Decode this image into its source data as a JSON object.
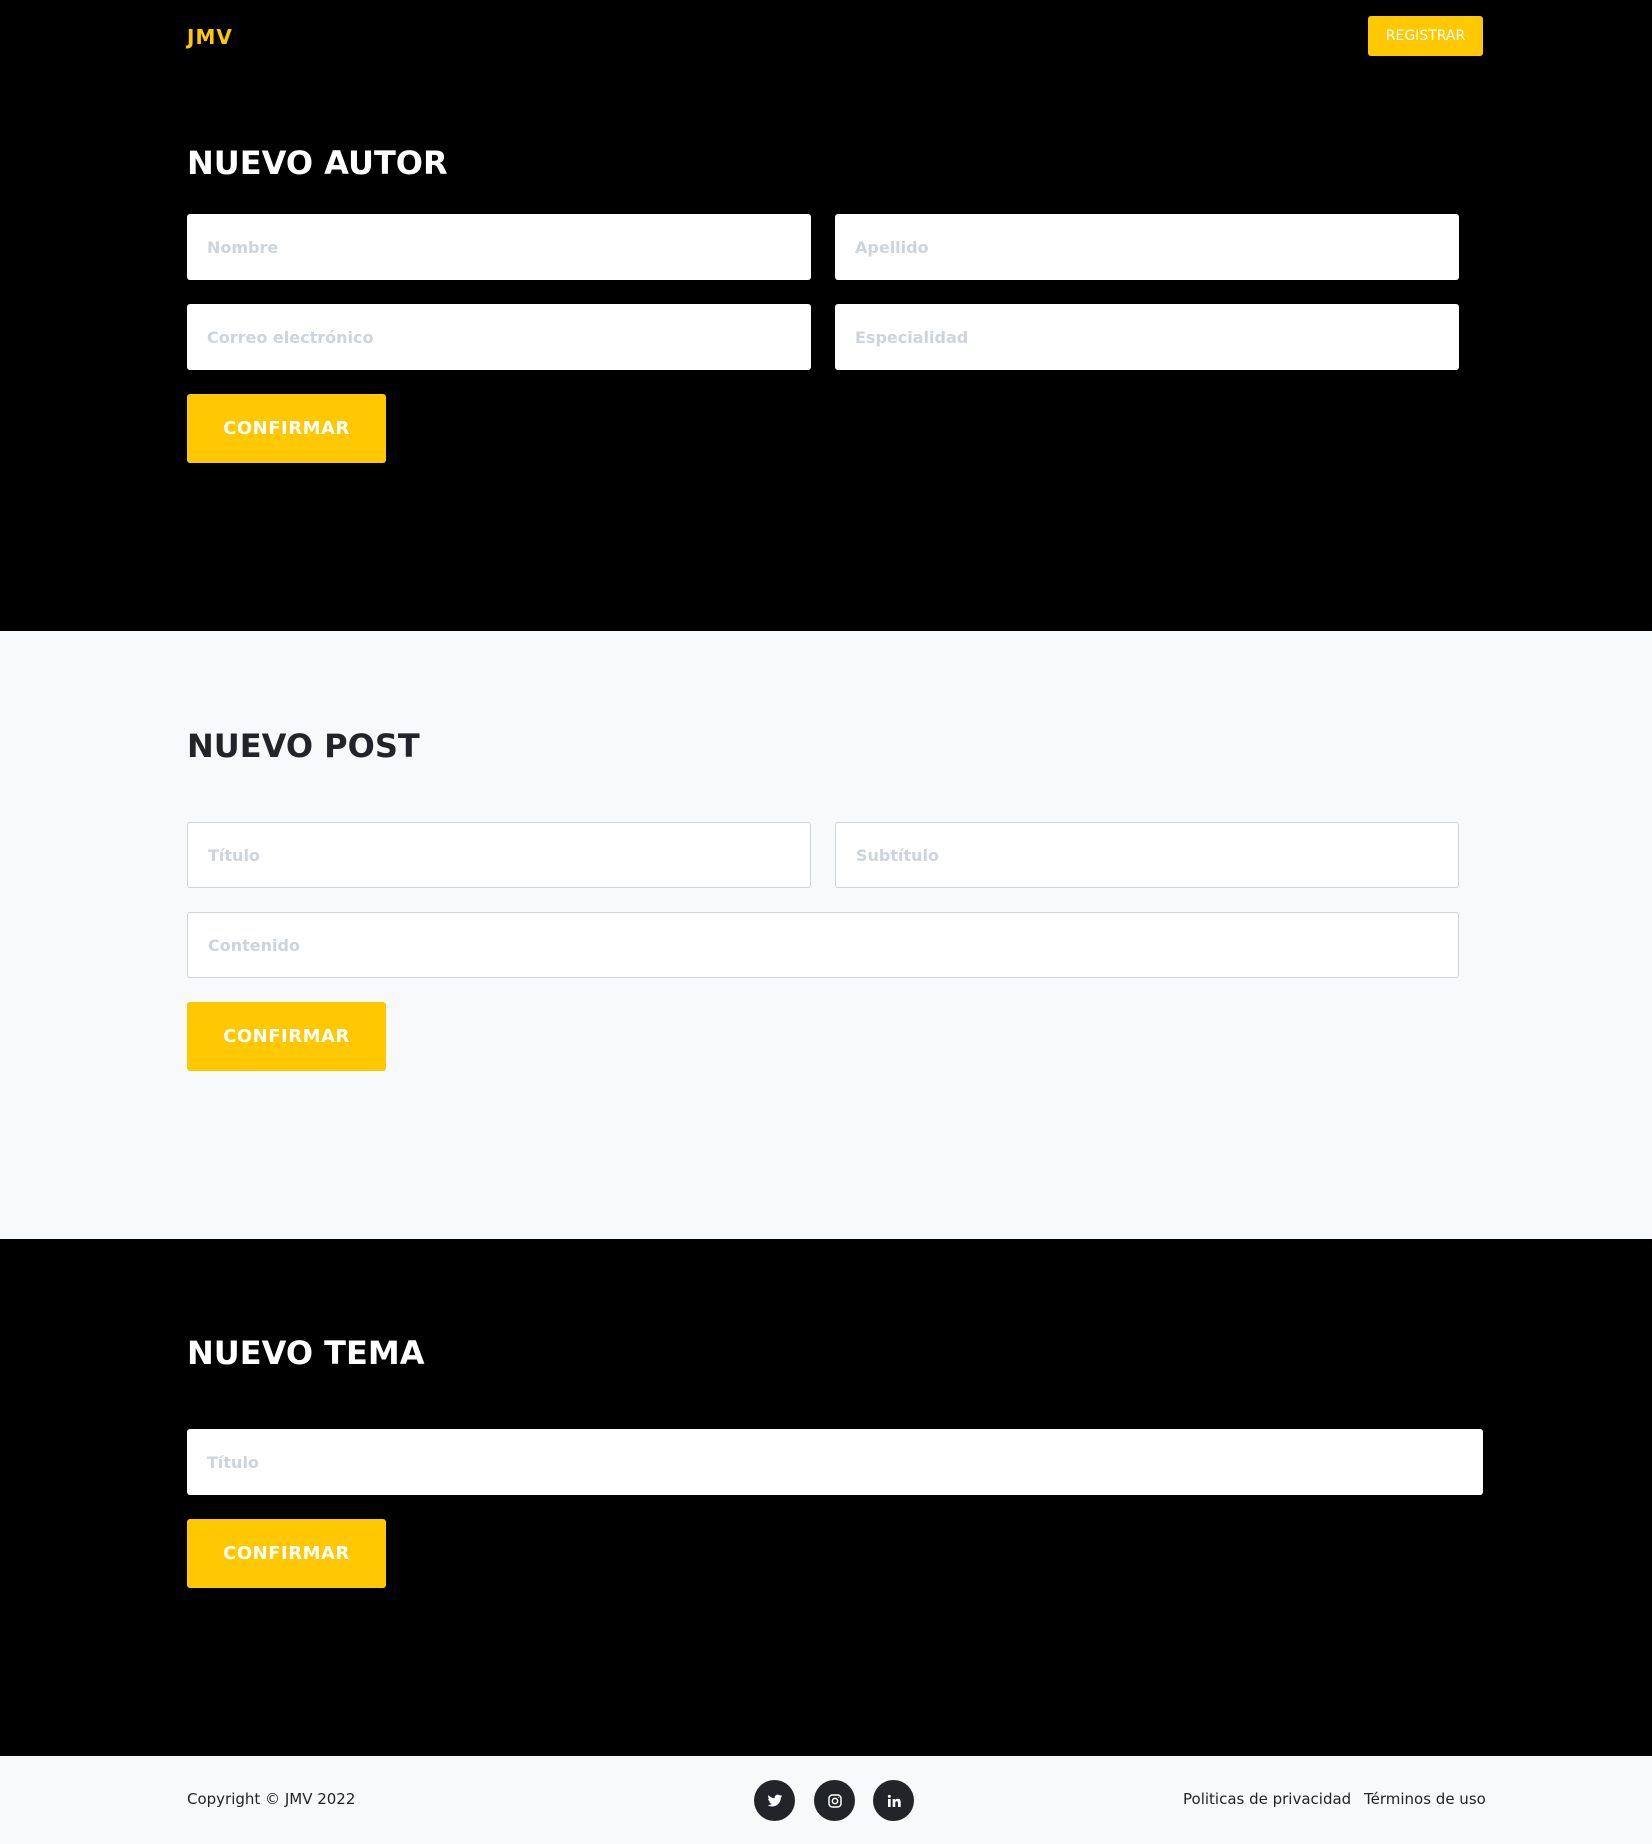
{
  "navbar": {
    "brand": "JMV",
    "register_label": "REGISTRAR"
  },
  "autor": {
    "title": "NUEVO AUTOR",
    "nombre_placeholder": "Nombre",
    "apellido_placeholder": "Apellido",
    "email_placeholder": "Correo electrónico",
    "especialidad_placeholder": "Especialidad",
    "confirm_label": "CONFIRMAR"
  },
  "post": {
    "title": "NUEVO POST",
    "titulo_placeholder": "Título",
    "subtitulo_placeholder": "Subtítulo",
    "contenido_placeholder": "Contenido",
    "confirm_label": "CONFIRMAR"
  },
  "tema": {
    "title": "NUEVO TEMA",
    "titulo_placeholder": "Título",
    "confirm_label": "CONFIRMAR"
  },
  "footer": {
    "copyright": "Copyright © JMV 2022",
    "social_icons": [
      "twitter-icon",
      "instagram-icon",
      "linkedin-icon"
    ],
    "privacy_label": "Politicas de privacidad",
    "terms_label": "Términos de uso"
  },
  "colors": {
    "accent": "#ffc800",
    "dark": "#000000",
    "light": "#f8f9fa",
    "text_dark": "#212529",
    "placeholder": "#ced4da"
  }
}
